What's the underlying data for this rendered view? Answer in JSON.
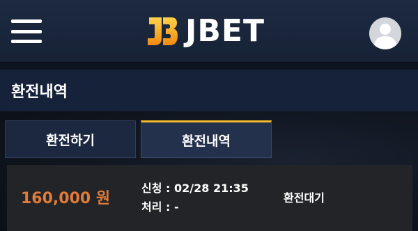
{
  "header": {
    "logo_text": "JBET",
    "logo_mark_letters": "JB",
    "menu_icon": "hamburger-icon",
    "avatar_icon": "user-avatar-icon"
  },
  "page": {
    "title": "환전내역"
  },
  "tabs": [
    {
      "label": "환전하기",
      "active": false
    },
    {
      "label": "환전내역",
      "active": true
    }
  ],
  "records": [
    {
      "amount": "160,000 원",
      "applied_label": "신청 :",
      "applied_value": "02/28 21:35",
      "processed_label": "처리 :",
      "processed_value": "-",
      "status": "환전대기"
    }
  ],
  "colors": {
    "accent": "#f2b928",
    "amount": "#e07b39",
    "header_bg": "#1d2a40",
    "title_bar_bg": "#16223a",
    "record_bg": "#232427"
  }
}
